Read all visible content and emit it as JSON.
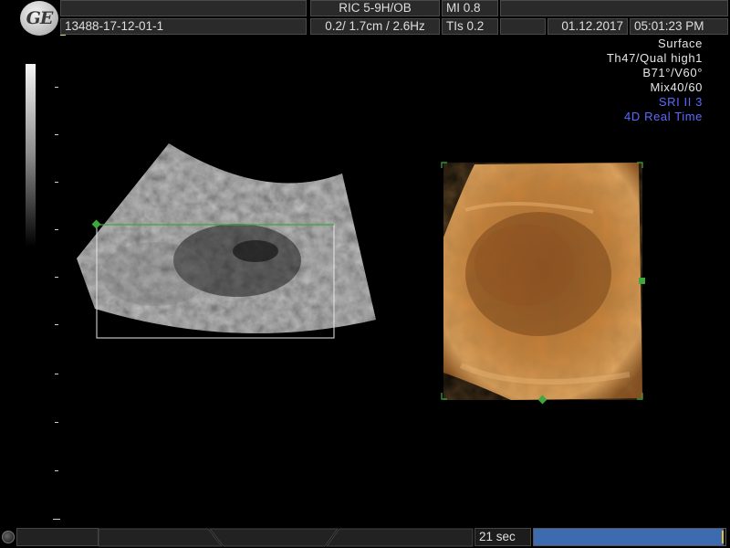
{
  "header": {
    "logo": "GE",
    "patient_id": "13488-17-12-01-1",
    "probe": "RIC 5-9H/OB",
    "mi": "MI  0.8",
    "focus_freq": "0.2/ 1.7cm / 2.6Hz",
    "tis": "TIs  0.2",
    "date": "01.12.2017",
    "time": "05:01:23 PM"
  },
  "info_panel": {
    "lines": [
      "Surface",
      "Th47/Qual high1",
      "B71°/V60°",
      "Mix40/60"
    ],
    "blue_lines": [
      "SRI II 3",
      "4D Real Time"
    ]
  },
  "bottom_bar": {
    "timer": "21 sec",
    "progress_fraction": 0.99
  },
  "colors": {
    "accent_blue": "#5b6bff",
    "roi_green": "#3ea83e",
    "render_orange": "#c07a30"
  }
}
